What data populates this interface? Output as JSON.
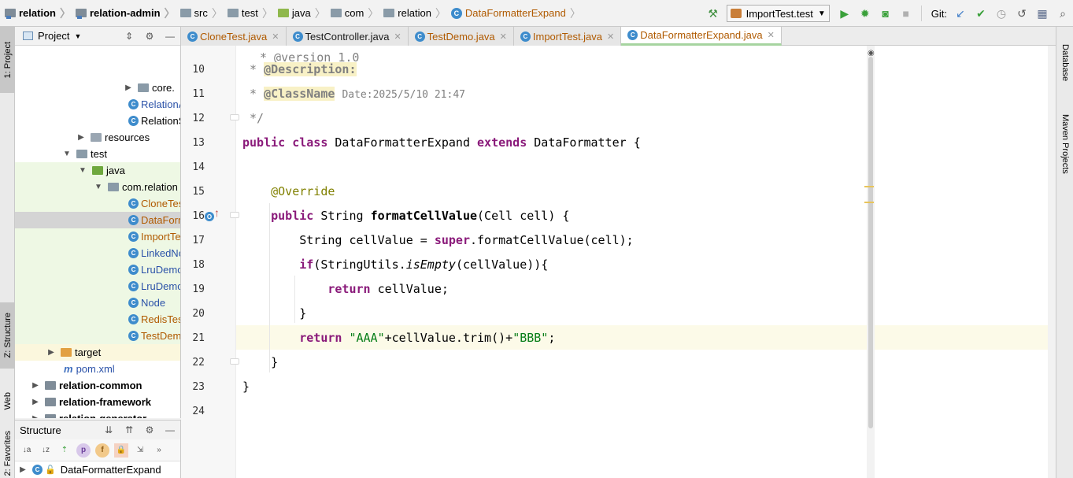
{
  "breadcrumb": [
    "relation",
    "relation-admin",
    "src",
    "test",
    "java",
    "com",
    "relation",
    "DataFormatterExpand"
  ],
  "run_config": {
    "label": "ImportTest.test"
  },
  "git": {
    "label": "Git:"
  },
  "left_strip": {
    "project": "1: Project",
    "structure": "Z: Structure",
    "web": "Web",
    "favorites": "2: Favorites"
  },
  "project_panel": {
    "title": "Project",
    "tree": [
      {
        "label": "core."
      },
      {
        "label": "RelationA"
      },
      {
        "label": "RelationS"
      },
      {
        "label": "resources"
      },
      {
        "label": "test"
      },
      {
        "label": "java"
      },
      {
        "label": "com.relation"
      },
      {
        "label": "CloneTest"
      },
      {
        "label": "DataForm"
      },
      {
        "label": "ImportTe"
      },
      {
        "label": "LinkedNo"
      },
      {
        "label": "LruDemo"
      },
      {
        "label": "LruDemo"
      },
      {
        "label": "Node"
      },
      {
        "label": "RedisTest"
      },
      {
        "label": "TestDem"
      },
      {
        "label": "target"
      },
      {
        "label": "pom.xml"
      },
      {
        "label": "relation-common"
      },
      {
        "label": "relation-framework"
      },
      {
        "label": "relation-generator"
      }
    ]
  },
  "structure_panel": {
    "title": "Structure",
    "item": "DataFormatterExpand"
  },
  "tabs": [
    {
      "label": "CloneTest.java"
    },
    {
      "label": "TestController.java"
    },
    {
      "label": "TestDemo.java"
    },
    {
      "label": "ImportTest.java"
    },
    {
      "label": "DataFormatterExpand.java"
    }
  ],
  "editor": {
    "lines": [
      {
        "n": "10"
      },
      {
        "n": "11"
      },
      {
        "n": "12"
      },
      {
        "n": "13"
      },
      {
        "n": "14"
      },
      {
        "n": "15"
      },
      {
        "n": "16"
      },
      {
        "n": "17"
      },
      {
        "n": "18"
      },
      {
        "n": "19"
      },
      {
        "n": "20"
      },
      {
        "n": "21"
      },
      {
        "n": "22"
      },
      {
        "n": "23"
      },
      {
        "n": "24"
      }
    ],
    "date_comment": "Date:2025/5/10 21:47"
  },
  "right_strip": {
    "database": "Database",
    "maven": "Maven Projects"
  }
}
